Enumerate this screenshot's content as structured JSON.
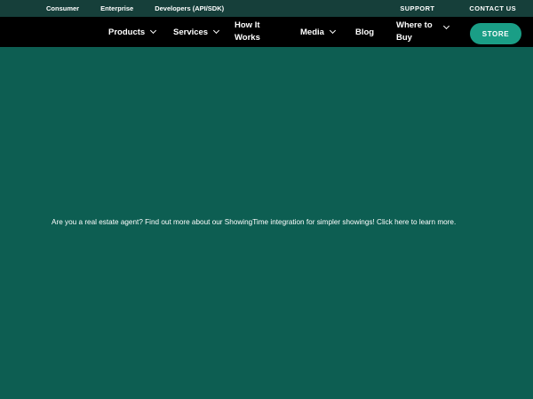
{
  "utility_bar": {
    "left_links": [
      "Consumer",
      "Enterprise",
      "Developers (API/SDK)"
    ],
    "support": "SUPPORT",
    "contact": "CONTACT US"
  },
  "nav": {
    "products": "Products",
    "services": "Services",
    "how_it_works": "How It Works",
    "media": "Media",
    "blog": "Blog",
    "where_to_buy": "Where to Buy",
    "store": "STORE"
  },
  "main": {
    "message": "Are you a real estate agent? Find out more about our ShowingTime integration for simpler showings! Click here to learn more."
  },
  "colors": {
    "page_background": "#0d5e52",
    "utility_bar": "#163f3a",
    "nav_bar": "#000000",
    "store_button": "#1a9e86"
  }
}
